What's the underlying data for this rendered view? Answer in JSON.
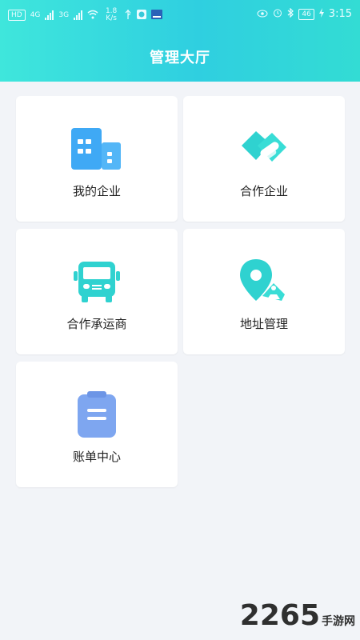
{
  "status_bar": {
    "left_items": [
      "HD",
      "4G",
      "3G"
    ],
    "speed_value": "1.8",
    "speed_unit": "K/s",
    "right_battery": "46",
    "time": "3:15"
  },
  "header": {
    "title": "管理大厅"
  },
  "cards": [
    {
      "label": "我的企业",
      "icon": "building-icon"
    },
    {
      "label": "合作企业",
      "icon": "handshake-icon"
    },
    {
      "label": "合作承运商",
      "icon": "bus-icon"
    },
    {
      "label": "地址管理",
      "icon": "location-pin-icon"
    },
    {
      "label": "账单中心",
      "icon": "clipboard-icon"
    }
  ],
  "watermark": {
    "number": "2265",
    "text": "手游网"
  },
  "colors": {
    "header_start": "#3fe6dc",
    "header_end": "#2fcfe0",
    "icon_blue": "#3fa9f5",
    "icon_teal": "#2fd2d0",
    "icon_clip": "#7ea6f0",
    "background": "#f2f4f8"
  }
}
